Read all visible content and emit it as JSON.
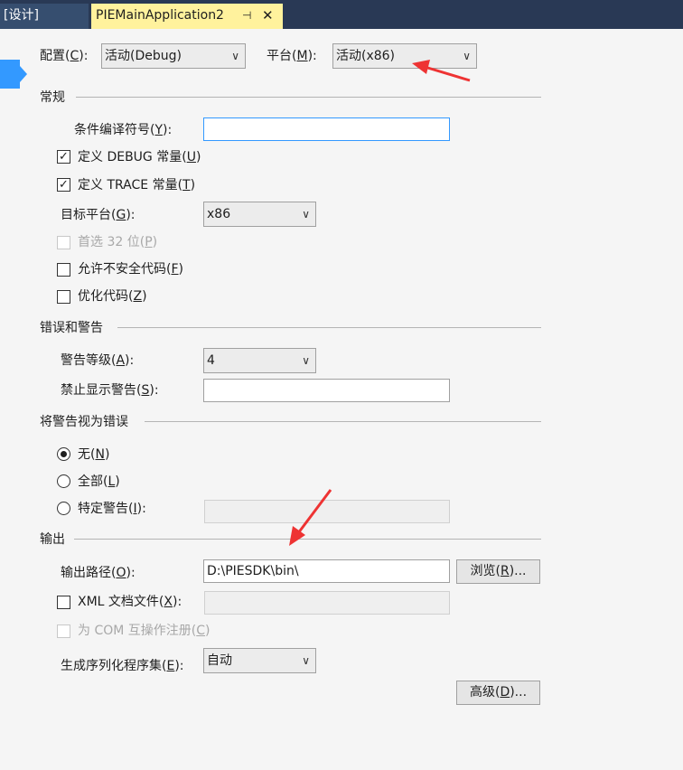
{
  "tabs": {
    "design": "[设计]",
    "active": "PIEMainApplication2",
    "pin_glyph": "⊣",
    "close_glyph": "✕"
  },
  "top": {
    "config_label_pre": "配置(",
    "config_label_key": "C",
    "config_label_post": "):",
    "config_value": "活动(Debug)",
    "platform_label_pre": "平台(",
    "platform_label_key": "M",
    "platform_label_post": "):",
    "platform_value": "活动(x86)"
  },
  "general": {
    "title": "常规",
    "cond_symbols_pre": "条件编译符号(",
    "cond_symbols_key": "Y",
    "cond_symbols_post": "):",
    "cond_symbols_value": "",
    "define_debug_pre": "定义 DEBUG 常量(",
    "define_debug_key": "U",
    "define_debug_post": ")",
    "define_debug_checked": true,
    "define_trace_pre": "定义 TRACE 常量(",
    "define_trace_key": "T",
    "define_trace_post": ")",
    "define_trace_checked": true,
    "target_platform_pre": "目标平台(",
    "target_platform_key": "G",
    "target_platform_post": "):",
    "target_platform_value": "x86",
    "prefer32_pre": "首选 32 位(",
    "prefer32_key": "P",
    "prefer32_post": ")",
    "unsafe_pre": "允许不安全代码(",
    "unsafe_key": "F",
    "unsafe_post": ")",
    "optimize_pre": "优化代码(",
    "optimize_key": "Z",
    "optimize_post": ")"
  },
  "errors": {
    "title": "错误和警告",
    "warning_level_pre": "警告等级(",
    "warning_level_key": "A",
    "warning_level_post": "):",
    "warning_level_value": "4",
    "suppress_pre": "禁止显示警告(",
    "suppress_key": "S",
    "suppress_post": "):",
    "suppress_value": ""
  },
  "treat_warnings": {
    "title": "将警告视为错误",
    "none_pre": "无(",
    "none_key": "N",
    "none_post": ")",
    "all_pre": "全部(",
    "all_key": "L",
    "all_post": ")",
    "specific_pre": "特定警告(",
    "specific_key": "I",
    "specific_post": "):",
    "selected": "none"
  },
  "output": {
    "title": "输出",
    "path_pre": "输出路径(",
    "path_key": "O",
    "path_post": "):",
    "path_value": "D:\\PIESDK\\bin\\",
    "browse_pre": "浏览(",
    "browse_key": "R",
    "browse_post": ")...",
    "xml_pre": "XML 文档文件(",
    "xml_key": "X",
    "xml_post": "):",
    "com_pre": "为 COM 互操作注册(",
    "com_key": "C",
    "com_post": ")",
    "serialize_pre": "生成序列化程序集(",
    "serialize_key": "E",
    "serialize_post": "):",
    "serialize_value": "自动",
    "advanced_pre": "高级(",
    "advanced_key": "D",
    "advanced_post": ")..."
  },
  "icons": {
    "check": "✓",
    "dropdown": "﹀"
  },
  "colors": {
    "tabbar": "#293955",
    "active_tab": "#fff29d",
    "accent": "#3399ff"
  }
}
